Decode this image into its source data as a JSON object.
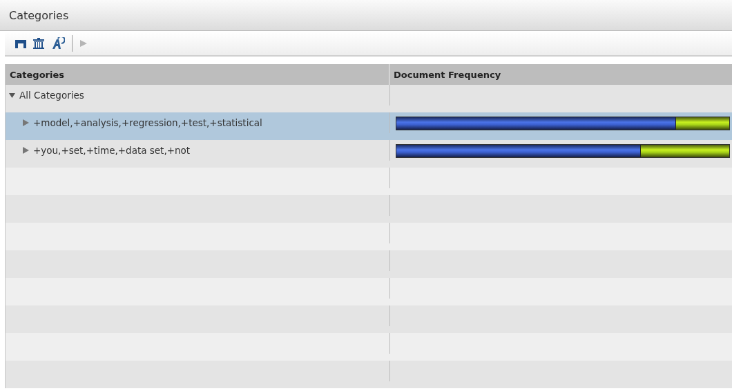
{
  "panel": {
    "title": "Categories"
  },
  "toolbar": [
    {
      "kind": "gate",
      "disabled": false
    },
    {
      "kind": "trash",
      "disabled": false
    },
    {
      "kind": "rename",
      "disabled": false
    },
    {
      "kind": "run",
      "disabled": true
    }
  ],
  "table": {
    "columns": [
      "Categories",
      "Document Frequency"
    ],
    "tree": {
      "label": "All Categories",
      "expanded": true,
      "selected": false,
      "children": [
        {
          "label": "+model,+analysis,+regression,+test,+statistical",
          "expanded": false,
          "selected": true,
          "level": 0.84
        },
        {
          "label": "+you,+set,+time,+data set,+not",
          "expanded": false,
          "selected": false,
          "level": 0.735
        }
      ]
    }
  }
}
